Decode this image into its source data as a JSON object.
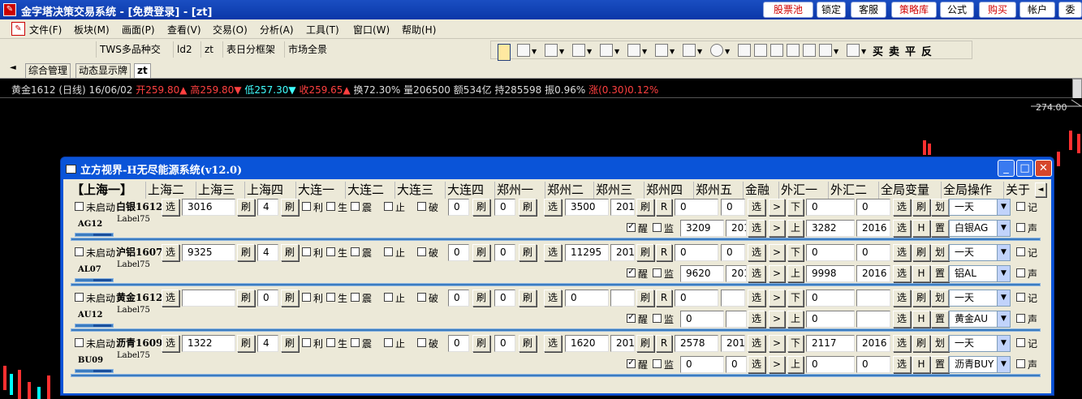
{
  "app": {
    "title": "金字塔决策交易系统 - [免费登录] - [zt]",
    "title_buttons": [
      "股票池",
      "锁定",
      "客服",
      "策略库",
      "公式",
      "购买",
      "帐户",
      "委"
    ]
  },
  "menu": [
    "文件(F)",
    "板块(M)",
    "画面(P)",
    "查看(V)",
    "交易(O)",
    "分析(A)",
    "工具(T)",
    "窗口(W)",
    "帮助(H)"
  ],
  "toolbar": {
    "items": [
      "TWS多品种交",
      "ld2",
      "zt",
      "表日分框架",
      "市场全景"
    ],
    "trade_chars": [
      "买",
      "卖",
      "平",
      "反"
    ]
  },
  "window_tabs": [
    "综合管理",
    "动态显示牌",
    "zt"
  ],
  "info": {
    "symbol": "黄金1612 (日线) 16/06/02",
    "open": "开259.80",
    "open_mark": "▲",
    "high": "高259.80",
    "high_mark": "▼",
    "low": "低257.30",
    "low_mark": "▼",
    "close": "收259.65",
    "close_mark": "▲",
    "turnover": "换72.30%",
    "volume": "量206500",
    "amount": "额534亿",
    "position": "持285598",
    "amplitude": "振0.96%",
    "change": "涨(0.30)0.12%"
  },
  "chart": {
    "price_label": "274.00"
  },
  "dialog": {
    "title": "立方视界-H无尽能源系统(v12.0)",
    "tabs": [
      "【上海一】",
      "上海二",
      "上海三",
      "上海四",
      "大连一",
      "大连二",
      "大连三",
      "大连四",
      "郑州一",
      "郑州二",
      "郑州三",
      "郑州四",
      "郑州五",
      "金融",
      "外汇一",
      "外汇二",
      "全局变量",
      "全局操作",
      "关于"
    ]
  },
  "labels": {
    "not_started": "未启动",
    "select": "选",
    "refresh": "刷",
    "profit": "利",
    "gen": "生",
    "shake": "震",
    "stop": "止",
    "break": "破",
    "r": "R",
    "gt": ">",
    "down": "下",
    "up": "上",
    "h": "H",
    "plan": "划",
    "set": "置",
    "wake": "醒",
    "watch": "监",
    "record": "记",
    "sound": "声",
    "label75": "Label75"
  },
  "rows": [
    {
      "name": "白银1612",
      "code": "AG12",
      "v1": "3016",
      "v2": "4",
      "v3": "0",
      "v4": "0",
      "v5": "3500",
      "v6": "201",
      "r1": "0",
      "r2": "0",
      "r3": "0",
      "r4": "0",
      "a1": "3209",
      "a2": "201",
      "b1": "3282",
      "b2": "2016",
      "period": "一天",
      "sym": "白银AG",
      "wake": true
    },
    {
      "name": "沪铝1607",
      "code": "AL07",
      "v1": "9325",
      "v2": "4",
      "v3": "0",
      "v4": "0",
      "v5": "11295",
      "v6": "201",
      "r1": "0",
      "r2": "0",
      "r3": "0",
      "r4": "0",
      "a1": "9620",
      "a2": "201",
      "b1": "9998",
      "b2": "2016",
      "period": "一天",
      "sym": "铝AL",
      "wake": true
    },
    {
      "name": "黄金1612",
      "code": "AU12",
      "v1": "",
      "v2": "0",
      "v3": "0",
      "v4": "0",
      "v5": "0",
      "v6": "",
      "r1": "0",
      "r2": "",
      "r3": "0",
      "r4": "",
      "a1": "0",
      "a2": "",
      "b1": "0",
      "b2": "",
      "period": "一天",
      "sym": "黄金AU",
      "wake": true
    },
    {
      "name": "沥青1609",
      "code": "BU09",
      "v1": "1322",
      "v2": "4",
      "v3": "0",
      "v4": "0",
      "v5": "1620",
      "v6": "201",
      "r1": "2578",
      "r2": "201",
      "r3": "2117",
      "r4": "2016",
      "a1": "0",
      "a2": "0",
      "b1": "0",
      "b2": "0",
      "period": "一天",
      "sym": "沥青BUY",
      "wake": true
    }
  ]
}
